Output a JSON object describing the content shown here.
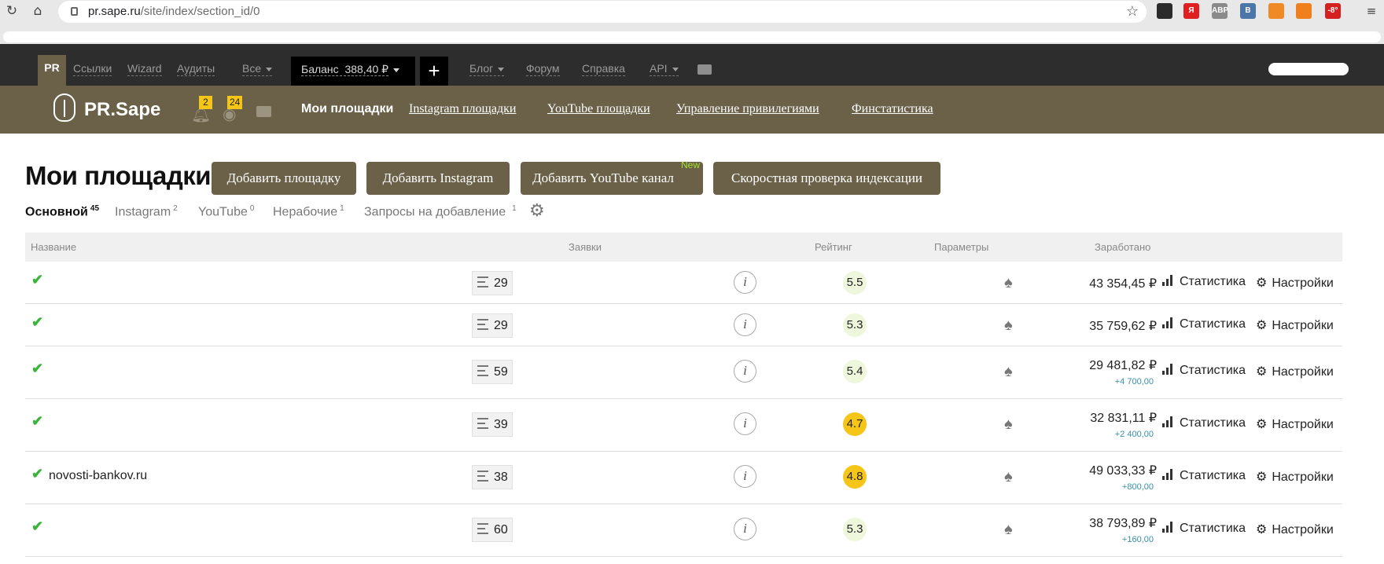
{
  "browser": {
    "url_host": "pr.sape.ru",
    "url_path": "/site/index/section_id/0",
    "extensions": [
      {
        "name": "ext-1",
        "label": "",
        "color": "#2b2b2b"
      },
      {
        "name": "yandex",
        "label": "Я",
        "color": "#e02020"
      },
      {
        "name": "adblock",
        "label": "ABP",
        "color": "#8a8a8a"
      },
      {
        "name": "vk",
        "label": "В",
        "color": "#4a76a8"
      },
      {
        "name": "rss",
        "label": "",
        "color": "#f08a24"
      },
      {
        "name": "ok",
        "label": "",
        "color": "#f07f1e"
      },
      {
        "name": "weather",
        "label": "-8°",
        "color": "#d42020"
      }
    ]
  },
  "topnav": {
    "pr": "PR",
    "links": [
      "Ссылки",
      "Wizard",
      "Аудиты"
    ],
    "all": "Все",
    "balance_label": "Баланс",
    "balance_value": "388,40 ₽",
    "plus": "+",
    "right_links": [
      "Блог",
      "Форум",
      "Справка",
      "API"
    ]
  },
  "brand": {
    "name": "PR.Sape",
    "notifications_count": "2",
    "views_count": "24",
    "nav": [
      "Мои площадки",
      "Instagram площадки",
      "YouTube площадки",
      "Управление привилегиями",
      "Финстатистика"
    ]
  },
  "page": {
    "title": "Мои площадки",
    "buttons": {
      "add_site": "Добавить площадку",
      "add_instagram": "Добавить Instagram",
      "add_youtube": "Добавить YouTube канал",
      "new_badge": "New",
      "index_check": "Скоростная проверка индексации"
    },
    "tabs": [
      {
        "label": "Основной",
        "count": "45"
      },
      {
        "label": "Instagram",
        "count": "2"
      },
      {
        "label": "YouTube",
        "count": "0"
      },
      {
        "label": "Нерабочие",
        "count": "1"
      },
      {
        "label": "Запросы на добавление",
        "count": "1"
      }
    ]
  },
  "table": {
    "headers": {
      "name": "Название",
      "requests": "Заявки",
      "rating": "Рейтинг",
      "params": "Параметры",
      "earned": "Заработано"
    },
    "stat_label": "Статистика",
    "settings_label": "Настройки",
    "info_glyph": "i",
    "rows": [
      {
        "name": "",
        "requests": "29",
        "rating": "5.5",
        "rating_color": "#eef6dc",
        "earned": "43 354,45 ₽",
        "delta": ""
      },
      {
        "name": "",
        "requests": "29",
        "rating": "5.3",
        "rating_color": "#eef6dc",
        "earned": "35 759,62 ₽",
        "delta": ""
      },
      {
        "name": "",
        "requests": "59",
        "rating": "5.4",
        "rating_color": "#eef6dc",
        "earned": "29 481,82 ₽",
        "delta": "+4 700,00"
      },
      {
        "name": "",
        "requests": "39",
        "rating": "4.7",
        "rating_color": "#f5c518",
        "earned": "32 831,11 ₽",
        "delta": "+2 400,00"
      },
      {
        "name": "novosti-bankov.ru",
        "requests": "38",
        "rating": "4.8",
        "rating_color": "#f5c518",
        "earned": "49 033,33 ₽",
        "delta": "+800,00"
      },
      {
        "name": "",
        "requests": "60",
        "rating": "5.3",
        "rating_color": "#eef6dc",
        "earned": "38 793,89 ₽",
        "delta": "+160,00"
      }
    ]
  }
}
